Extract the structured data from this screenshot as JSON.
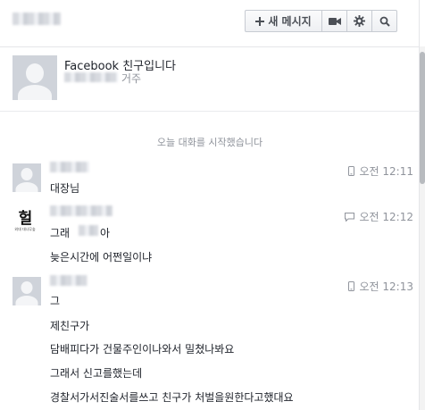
{
  "toolbar": {
    "new_message_label": "새 메시지"
  },
  "profile": {
    "network_line": "Facebook 친구입니다",
    "location_suffix": "거주"
  },
  "conversation": {
    "start_label": "오늘 대화를 시작했습니다"
  },
  "messages": [
    {
      "time": "오전 12:11",
      "lines": [
        "대장님"
      ]
    },
    {
      "time": "오전 12:12",
      "lines": [
        "그래",
        "아",
        "늦은시간에 어쩐일이냐"
      ],
      "avatar_text": {
        "big": "헐",
        "small": "외대 대나무숲"
      }
    },
    {
      "time": "오전 12:13",
      "lines": [
        "그",
        "제친구가",
        "담배피다가 건물주인이나와서 밀쳤나봐요",
        "그래서 신고를했는데",
        "경찰서가서진술서를쓰고 친구가 처벌을원한다고했대요"
      ]
    }
  ],
  "colors": {
    "text": "#1d2129",
    "muted": "#90949c",
    "divider": "#e5e6e9"
  }
}
